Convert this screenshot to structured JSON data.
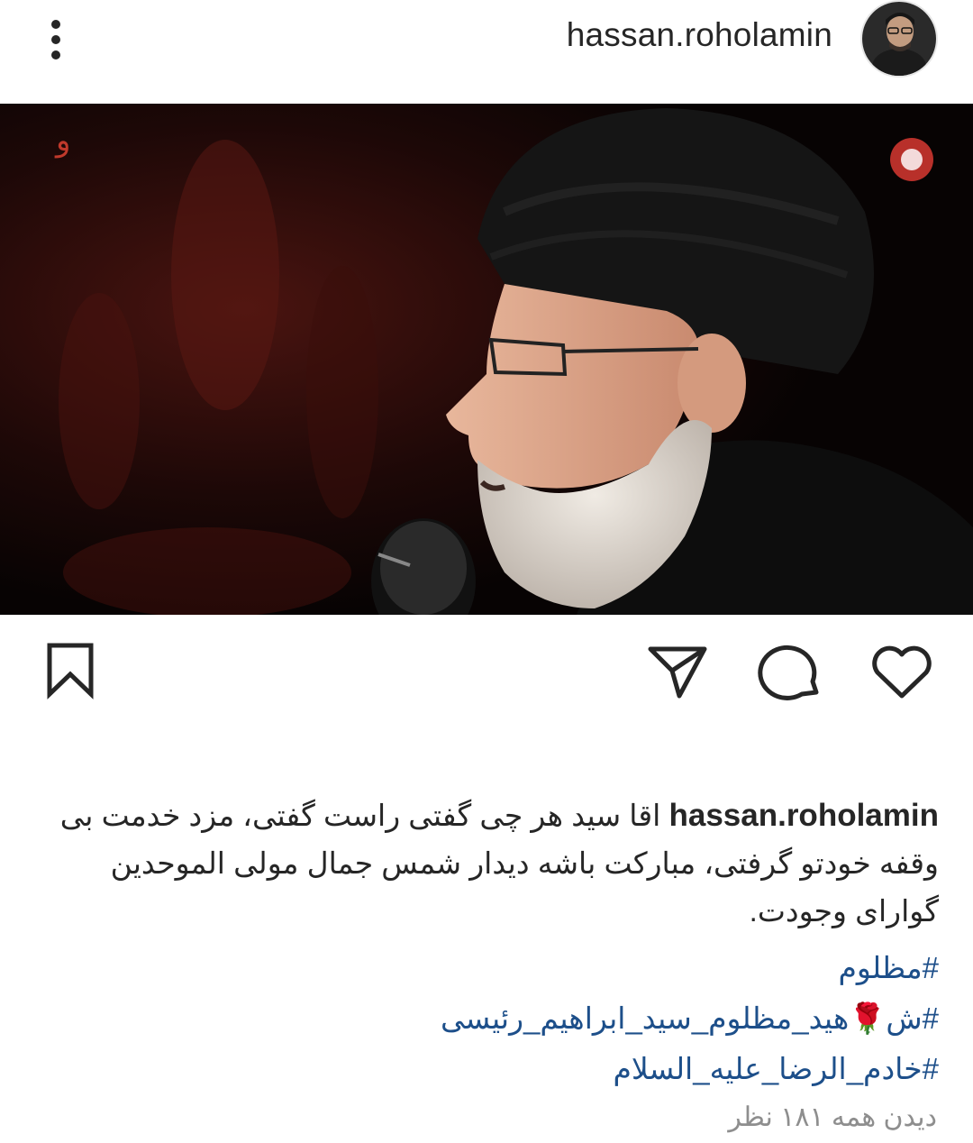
{
  "header": {
    "username": "hassan.roholamin",
    "avatar_icon": "profile-avatar",
    "more_icon": "more-vertical-icon"
  },
  "media": {
    "type": "video",
    "mute_icon": "speaker-muted-icon"
  },
  "actions": {
    "like_icon": "heart-icon",
    "comment_icon": "comment-bubble-icon",
    "share_icon": "paper-plane-icon",
    "save_icon": "bookmark-icon"
  },
  "caption": {
    "username": "hassan.roholamin",
    "text": "اقا سید هر چی  گفتی راست گفتی، مزد خدمت بی وقفه خودتو گرفتی، مبارکت باشه دیدار شمس جمال مولی الموحدین گوارای وجودت."
  },
  "hashtags": [
    "#مظلوم",
    "#ش🌹هید_مظلوم_سید_ابراهیم_رئیسی",
    "#خادم_الرضا_علیه_السلام"
  ],
  "view_count_text": "دیدن همه ۱۸۱ نظر",
  "colors": {
    "text": "#262626",
    "hashtag": "#1d4f8a",
    "muted_text": "#8e8e8e",
    "background": "#ffffff"
  }
}
